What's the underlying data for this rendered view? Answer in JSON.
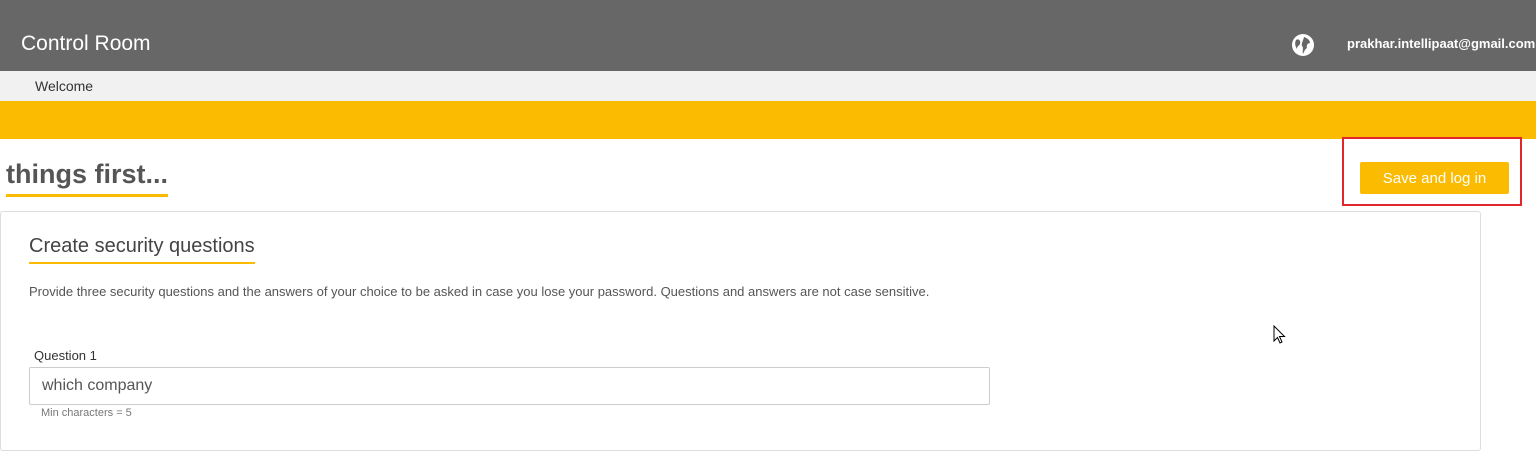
{
  "header": {
    "app_title": "Control Room",
    "globe_icon": "globe-icon",
    "user_email": "prakhar.intellipaat@gmail.com"
  },
  "subnav": {
    "label": "Welcome"
  },
  "page": {
    "title": "things first...",
    "save_button_label": "Save and log in"
  },
  "card": {
    "title": "Create security questions",
    "description": "Provide three security questions and the answers of your choice to be asked in case you lose your password. Questions and answers are not case sensitive.",
    "question1": {
      "label": "Question 1",
      "value": "which company",
      "hint": "Min characters = 5"
    }
  },
  "colors": {
    "topbar": "#676767",
    "accent": "#fbbb00",
    "highlight": "#e3262d"
  }
}
